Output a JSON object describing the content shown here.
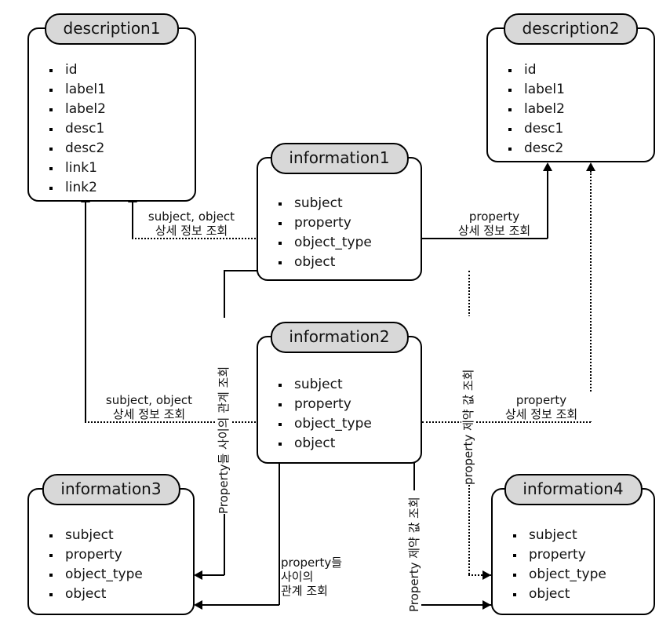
{
  "diagram": {
    "title": "Entity relationship diagram",
    "entities": [
      {
        "id": "description1",
        "name": "description1",
        "attributes": [
          "id",
          "label1",
          "label2",
          "desc1",
          "desc2",
          "link1",
          "link2"
        ]
      },
      {
        "id": "description2",
        "name": "description2",
        "attributes": [
          "id",
          "label1",
          "label2",
          "desc1",
          "desc2"
        ]
      },
      {
        "id": "information1",
        "name": "information1",
        "attributes": [
          "subject",
          "property",
          "object_type",
          "object"
        ]
      },
      {
        "id": "information2",
        "name": "information2",
        "attributes": [
          "subject",
          "property",
          "object_type",
          "object"
        ]
      },
      {
        "id": "information3",
        "name": "information3",
        "attributes": [
          "subject",
          "property",
          "object_type",
          "object"
        ]
      },
      {
        "id": "information4",
        "name": "information4",
        "attributes": [
          "subject",
          "property",
          "object_type",
          "object"
        ]
      }
    ],
    "edge_labels": {
      "info1_to_desc1": "subject, object\n상세 정보 조회",
      "info1_to_desc2": "property\n상세 정보 조회",
      "info2_to_desc1": "subject, object\n상세 정보 조회",
      "info2_to_desc2": "property\n상세 정보 조회",
      "info1_to_info3_vertical": "Property들 사이의 관계 조회",
      "info1_to_info4_vertical": "property 제약 값 조회",
      "info2_to_info3": "property들\n사이의\n관계 조회",
      "info2_to_info4_vertical": "Property 제약 값 조회"
    },
    "colors": {
      "title_fill": "#d8d8d8",
      "box_fill": "#ffffff",
      "stroke": "#000000",
      "text": "#111111"
    }
  }
}
